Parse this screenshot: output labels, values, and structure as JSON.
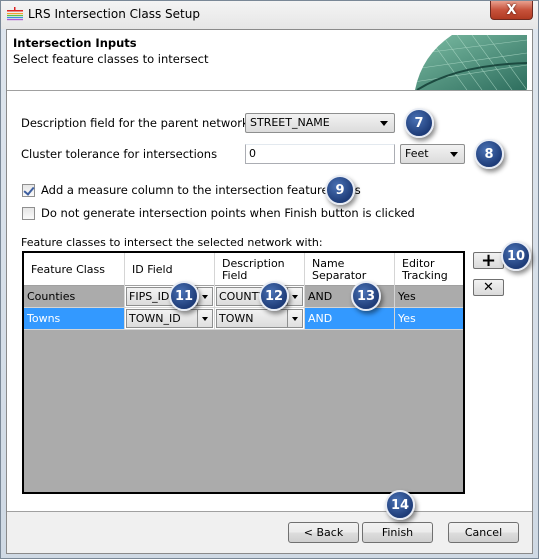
{
  "window": {
    "title": "LRS Intersection Class Setup",
    "close_glyph": "X"
  },
  "header": {
    "title": "Intersection Inputs",
    "subtitle": "Select feature classes to intersect"
  },
  "form": {
    "description_field_label": "Description field for the parent network:",
    "description_field_value": "STREET_NAME",
    "cluster_tolerance_label": "Cluster tolerance for intersections",
    "cluster_tolerance_value": "0",
    "cluster_units_value": "Feet",
    "add_measure_label": "Add a measure column to the intersection feature class",
    "add_measure_checked": true,
    "no_generate_label": "Do not generate intersection points when Finish button is clicked",
    "no_generate_checked": false,
    "grid_label": "Feature classes to intersect the selected network with:"
  },
  "grid": {
    "columns": [
      {
        "label": "Feature Class"
      },
      {
        "label": "ID Field"
      },
      {
        "label": "Description Field"
      },
      {
        "label": "Name Separator"
      },
      {
        "label": "Editor Tracking"
      }
    ],
    "rows": [
      {
        "feature_class": "Counties",
        "id_field": "FIPS_ID",
        "description_field": "COUNTY",
        "name_separator": "AND",
        "editor_tracking": "Yes",
        "selected": false
      },
      {
        "feature_class": "Towns",
        "id_field": "TOWN_ID",
        "description_field": "TOWN",
        "name_separator": "AND",
        "editor_tracking": "Yes",
        "selected": true
      }
    ]
  },
  "side_buttons": {
    "add_glyph": "+",
    "remove_glyph": "✕"
  },
  "footer": {
    "back_label": "< Back",
    "finish_label": "Finish",
    "cancel_label": "Cancel"
  },
  "callouts": [
    "7",
    "8",
    "9",
    "10",
    "11",
    "12",
    "13",
    "14"
  ],
  "colors": {
    "selection": "#3399ff",
    "grid_background": "#ababab",
    "callout": "#1e3c78",
    "close_button": "#c7523b"
  }
}
